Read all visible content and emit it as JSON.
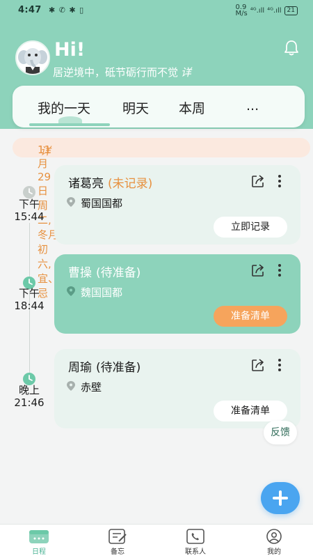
{
  "status_bar": {
    "time": "4:47",
    "left_icons": "✱ ✆ ✱ ▯",
    "net_speed": "0.9\nM/s",
    "signal1": "⁴ᴳ.ıll",
    "signal2": "⁴ᴳ.ıll",
    "battery": "21"
  },
  "header": {
    "greeting": "Hi!",
    "motto": "居逆境中，砥节砺行而不觉",
    "motto_link": "详"
  },
  "tabs": [
    {
      "label": "我的一天",
      "active": true
    },
    {
      "label": "明天",
      "active": false
    },
    {
      "label": "本周",
      "active": false
    },
    {
      "label": "...",
      "active": false
    }
  ],
  "date_bar": {
    "text": "11月29日 周二,冬月初六, 宜、忌",
    "link": "详"
  },
  "timeline": [
    {
      "period": "下午",
      "time": "15:44",
      "icon": "clock-icon",
      "icon_color": "#c9cfcc"
    },
    {
      "period": "下午",
      "time": "18:44",
      "icon": "clock-icon",
      "icon_color": "#6cc9a8"
    },
    {
      "period": "晚上",
      "time": "21:46",
      "icon": "clock-icon",
      "icon_color": "#6cc9a8"
    }
  ],
  "events": [
    {
      "name": "诸葛亮",
      "status": "(未记录)",
      "location": "蜀国国都",
      "action": "立即记录",
      "active": false
    },
    {
      "name": "曹操",
      "status": "(待准备)",
      "location": "魏国国都",
      "action": "准备清单",
      "active": true
    },
    {
      "name": "周瑜",
      "status": "(待准备)",
      "location": "赤壁",
      "action": "准备清单",
      "active": false
    }
  ],
  "feedback": "反馈",
  "bottom_nav": [
    {
      "label": "日程",
      "icon": "calendar-icon",
      "active": true
    },
    {
      "label": "备忘",
      "icon": "memo-icon",
      "active": false
    },
    {
      "label": "联系人",
      "icon": "contacts-icon",
      "active": false
    },
    {
      "label": "我的",
      "icon": "profile-icon",
      "active": false
    }
  ],
  "colors": {
    "primary": "#8dd3bb",
    "accent": "#e7903e",
    "fab": "#4aa5f0",
    "orange_button": "#f6a45c"
  }
}
